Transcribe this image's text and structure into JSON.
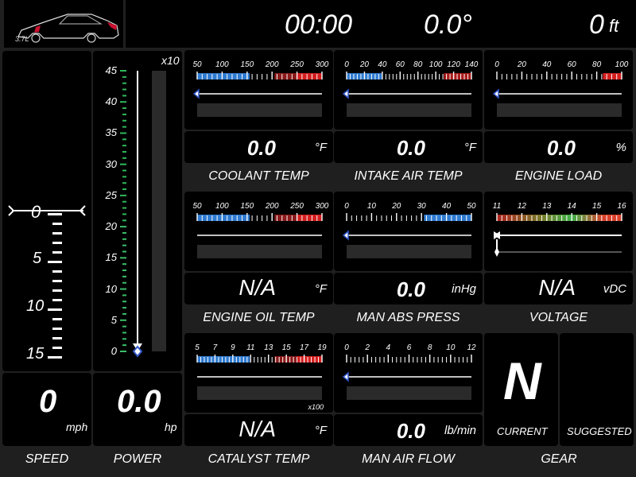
{
  "header": {
    "engine_badge": "3.7L",
    "clock": "00:00",
    "angle": "0.0°",
    "altitude_value": "0",
    "altitude_unit": "ft"
  },
  "speed": {
    "title": "SPEED",
    "value": "0",
    "unit": "mph",
    "indicator": "0",
    "tape_labels": [
      "0",
      "5",
      "10",
      "15"
    ]
  },
  "power": {
    "title": "POWER",
    "value": "0.0",
    "unit": "hp",
    "multiplier": "x10",
    "scale_labels": [
      "45",
      "40",
      "35",
      "30",
      "25",
      "20",
      "15",
      "10",
      "5",
      "0"
    ]
  },
  "gauges": {
    "coolant": {
      "title": "COOLANT TEMP",
      "value": "0.0",
      "unit": "°F",
      "scale": [
        "50",
        "100",
        "150",
        "200",
        "250",
        "300"
      ]
    },
    "intake": {
      "title": "INTAKE AIR TEMP",
      "value": "0.0",
      "unit": "°F",
      "scale": [
        "0",
        "20",
        "40",
        "60",
        "80",
        "100",
        "120",
        "140"
      ]
    },
    "load": {
      "title": "ENGINE LOAD",
      "value": "0.0",
      "unit": "%",
      "scale": [
        "0",
        "20",
        "40",
        "60",
        "80",
        "100"
      ]
    },
    "oil": {
      "title": "ENGINE OIL TEMP",
      "value": "N/A",
      "unit": "°F",
      "scale": [
        "50",
        "100",
        "150",
        "200",
        "250",
        "300"
      ]
    },
    "map": {
      "title": "MAN ABS PRESS",
      "value": "0.0",
      "unit": "inHg",
      "scale": [
        "0",
        "10",
        "20",
        "30",
        "40",
        "50"
      ]
    },
    "voltage": {
      "title": "VOLTAGE",
      "value": "N/A",
      "unit": "vDC",
      "scale": [
        "11",
        "12",
        "13",
        "14",
        "15",
        "16"
      ]
    },
    "catalyst": {
      "title": "CATALYST TEMP",
      "value": "N/A",
      "unit": "°F",
      "scale": [
        "5",
        "7",
        "9",
        "11",
        "13",
        "15",
        "17",
        "19"
      ],
      "multiplier": "x100"
    },
    "maf": {
      "title": "MAN AIR FLOW",
      "value": "0.0",
      "unit": "lb/min",
      "scale": [
        "0",
        "2",
        "4",
        "6",
        "8",
        "10",
        "12"
      ]
    }
  },
  "gear": {
    "title": "GEAR",
    "current_value": "N",
    "current_label": "CURRENT",
    "suggested_label": "SUGGESTED"
  }
}
